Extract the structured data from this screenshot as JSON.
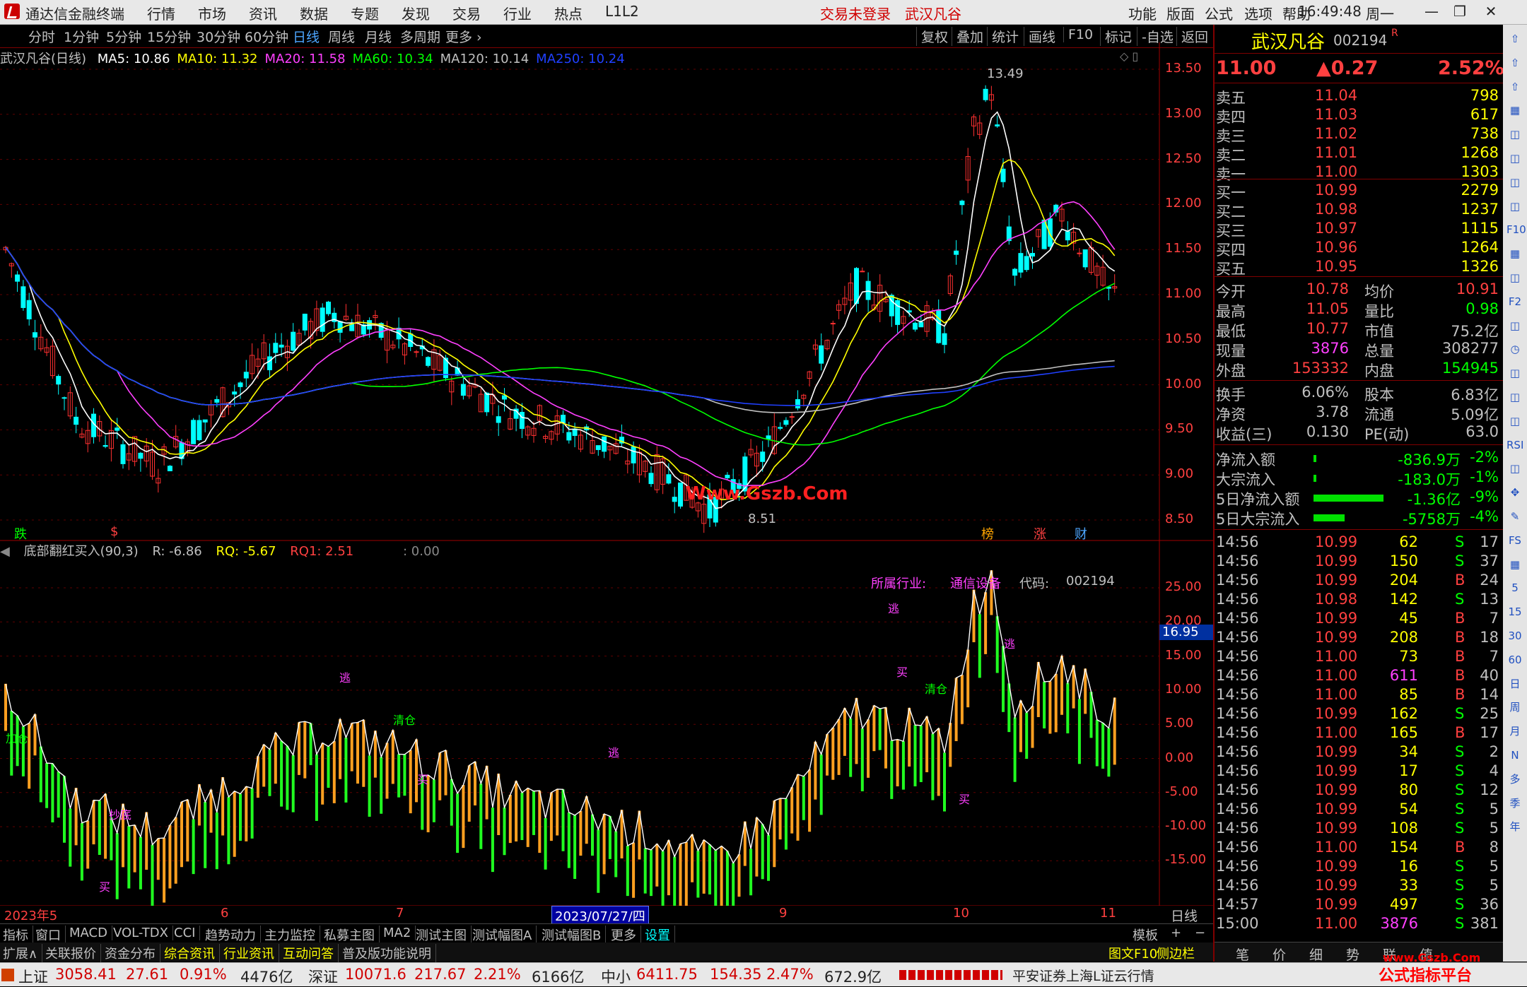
{
  "menubar": {
    "app_title": "通达信金融终端",
    "menus": [
      "行情",
      "市场",
      "资讯",
      "数据",
      "专题",
      "发现",
      "交易",
      "行业",
      "热点",
      "L1L2"
    ],
    "trade_status": "交易未登录",
    "stock_name": "武汉凡谷",
    "right_menus": [
      "功能",
      "版面",
      "公式",
      "选项",
      "帮助"
    ],
    "time": "16:49:48",
    "weekday": "周一"
  },
  "periodbar": {
    "periods": [
      "分时",
      "1分钟",
      "5分钟",
      "15分钟",
      "30分钟",
      "60分钟",
      "日线",
      "周线",
      "月线",
      "多周期",
      "更多 ›"
    ],
    "active_index": 6,
    "right_buttons": [
      "复权",
      "叠加",
      "统计",
      "画线",
      "F10",
      "标记",
      "-自选",
      "返回"
    ]
  },
  "main_chart": {
    "title": "武汉凡谷(日线)",
    "ma": [
      {
        "label": "MA5: 10.86",
        "color": "#ffffff"
      },
      {
        "label": "MA10: 11.32",
        "color": "#ffff00"
      },
      {
        "label": "MA20: 11.58",
        "color": "#ff40ff"
      },
      {
        "label": "MA60: 10.34",
        "color": "#00ff00"
      },
      {
        "label": "MA120: 10.14",
        "color": "#c0c0c0"
      },
      {
        "label": "MA250: 10.24",
        "color": "#2040ff"
      }
    ],
    "y_ticks": [
      "13.50",
      "13.00",
      "12.50",
      "12.00",
      "11.50",
      "11.00",
      "10.50",
      "10.00",
      "9.50",
      "9.00",
      "8.50"
    ],
    "high_label": "13.49",
    "low_label": "8.51",
    "watermark": "Www.Gszb.Com",
    "markers": [
      {
        "text": "跌",
        "color": "#00ff00"
      },
      {
        "text": "$",
        "color": "#ff4040"
      },
      {
        "text": "榜",
        "color": "#ffa500"
      },
      {
        "text": "涨",
        "color": "#ff4040"
      },
      {
        "text": "财",
        "color": "#4da6ff"
      }
    ]
  },
  "indicator": {
    "name": "底部翻红买入(90,3)",
    "r": "R: -6.86",
    "rq": "RQ: -5.67",
    "rq1": "RQ1: 2.51",
    "extra": ": 0.00",
    "industry_label": "所属行业:",
    "industry": "通信设备",
    "code_label": "代码:",
    "code": "002194",
    "y_ticks": [
      "25.00",
      "20.00",
      "15.00",
      "10.00",
      "5.00",
      "0.00",
      "-5.00",
      "-10.00",
      "-15.00"
    ],
    "current_value": "16.95",
    "signal_labels": [
      "逃",
      "买",
      "清仓",
      "抄底",
      "加仓"
    ]
  },
  "x_axis": {
    "labels": [
      "2023年5",
      "6",
      "7",
      "2023/07/27/四",
      "9",
      "10",
      "11"
    ],
    "period": "日线"
  },
  "tabs1": [
    "指标",
    "窗口",
    "MACD",
    "VOL-TDX",
    "CCI",
    "趋势动力",
    "主力监控",
    "私募主图",
    "MA2",
    "测试主图",
    "测试幅图A",
    "测试幅图B",
    "更多",
    "设置"
  ],
  "tabs1_right": [
    "模板",
    "+",
    "−"
  ],
  "tabs2": [
    "扩展∧",
    "关联报价",
    "资金分布",
    "综合资讯",
    "行业资讯",
    "互动问答",
    "普及版功能说明"
  ],
  "tabs2_right": [
    "图文F10",
    "侧边栏 《"
  ],
  "quote": {
    "name": "武汉凡谷",
    "code": "002194",
    "r_mark": "R",
    "price": "11.00",
    "change": "▲0.27",
    "pct": "2.52%",
    "asks": [
      {
        "label": "卖五",
        "price": "11.04",
        "vol": "798"
      },
      {
        "label": "卖四",
        "price": "11.03",
        "vol": "617"
      },
      {
        "label": "卖三",
        "price": "11.02",
        "vol": "738"
      },
      {
        "label": "卖二",
        "price": "11.01",
        "vol": "1268"
      },
      {
        "label": "卖一",
        "price": "11.00",
        "vol": "1303"
      }
    ],
    "bids": [
      {
        "label": "买一",
        "price": "10.99",
        "vol": "2279"
      },
      {
        "label": "买二",
        "price": "10.98",
        "vol": "1237"
      },
      {
        "label": "买三",
        "price": "10.97",
        "vol": "1115"
      },
      {
        "label": "买四",
        "price": "10.96",
        "vol": "1264"
      },
      {
        "label": "买五",
        "price": "10.95",
        "vol": "1326"
      }
    ],
    "stats": [
      {
        "l1": "今开",
        "v1": "10.78",
        "l2": "均价",
        "v2": "10.91",
        "c1": "#ff4040",
        "c2": "#ff4040"
      },
      {
        "l1": "最高",
        "v1": "11.05",
        "l2": "量比",
        "v2": "0.98",
        "c1": "#ff4040",
        "c2": "#00ff00"
      },
      {
        "l1": "最低",
        "v1": "10.77",
        "l2": "市值",
        "v2": "75.2亿",
        "c1": "#ff4040",
        "c2": "#c0c0c0"
      },
      {
        "l1": "现量",
        "v1": "3876",
        "l2": "总量",
        "v2": "308277",
        "c1": "#ff40ff",
        "c2": "#c0c0c0"
      },
      {
        "l1": "外盘",
        "v1": "153332",
        "l2": "内盘",
        "v2": "154945",
        "c1": "#ff4040",
        "c2": "#00ff00"
      }
    ],
    "stats2": [
      {
        "l1": "换手",
        "v1": "6.06%",
        "l2": "股本",
        "v2": "6.83亿"
      },
      {
        "l1": "净资",
        "v1": "3.78",
        "l2": "流通",
        "v2": "5.09亿"
      },
      {
        "l1": "收益(三)",
        "v1": "0.130",
        "l2": "PE(动)",
        "v2": "63.0"
      }
    ],
    "flows": [
      {
        "label": "净流入额",
        "value": "-836.9万",
        "pct": "-2%",
        "bar": 0.02
      },
      {
        "label": "大宗流入",
        "value": "-183.0万",
        "pct": "-1%",
        "bar": 0.01
      },
      {
        "label": "5日净流入额",
        "value": "-1.36亿",
        "pct": "-9%",
        "bar": 0.9
      },
      {
        "label": "5日大宗流入",
        "value": "-5758万",
        "pct": "-4%",
        "bar": 0.4
      }
    ],
    "ticks": [
      [
        "14:56",
        "10.99",
        "62",
        "S",
        "17"
      ],
      [
        "14:56",
        "10.99",
        "150",
        "S",
        "37"
      ],
      [
        "14:56",
        "10.99",
        "204",
        "B",
        "24"
      ],
      [
        "14:56",
        "10.98",
        "142",
        "S",
        "13"
      ],
      [
        "14:56",
        "10.99",
        "45",
        "B",
        "7"
      ],
      [
        "14:56",
        "10.99",
        "208",
        "B",
        "18"
      ],
      [
        "14:56",
        "11.00",
        "73",
        "B",
        "7"
      ],
      [
        "14:56",
        "11.00",
        "611",
        "B",
        "40"
      ],
      [
        "14:56",
        "11.00",
        "85",
        "B",
        "14"
      ],
      [
        "14:56",
        "10.99",
        "162",
        "S",
        "25"
      ],
      [
        "14:56",
        "11.00",
        "165",
        "B",
        "17"
      ],
      [
        "14:56",
        "10.99",
        "34",
        "S",
        "2"
      ],
      [
        "14:56",
        "10.99",
        "17",
        "S",
        "4"
      ],
      [
        "14:56",
        "10.99",
        "80",
        "S",
        "12"
      ],
      [
        "14:56",
        "10.99",
        "54",
        "S",
        "5"
      ],
      [
        "14:56",
        "10.99",
        "108",
        "S",
        "5"
      ],
      [
        "14:56",
        "11.00",
        "154",
        "B",
        "8"
      ],
      [
        "14:56",
        "10.99",
        "16",
        "S",
        "5"
      ],
      [
        "14:56",
        "10.99",
        "33",
        "S",
        "5"
      ],
      [
        "14:57",
        "10.99",
        "497",
        "S",
        "36"
      ],
      [
        "15:00",
        "11.00",
        "3876",
        "S",
        "381"
      ]
    ],
    "bottom_tabs": [
      "笔",
      "价",
      "细",
      "势",
      "联",
      "值"
    ]
  },
  "side_icons": [
    "up-icon",
    "up-icon",
    "up-icon",
    "grid-icon",
    "chart-icon",
    "chart-icon",
    "chart-icon",
    "chart-icon",
    "F10",
    "grid-icon",
    "chart-icon",
    "F2",
    "chart-icon",
    "clock-icon",
    "chart-icon",
    "chart-icon",
    "chart-icon",
    "RSI",
    "chart-icon",
    "move-icon",
    "pen-icon",
    "FS",
    "grid-icon",
    "5",
    "15",
    "30",
    "60",
    "日",
    "周",
    "月",
    "N",
    "多",
    "季",
    "年"
  ],
  "statusbar": {
    "sh_label": "上证",
    "sh_val": "3058.41",
    "sh_chg": "27.61",
    "sh_pct": "0.91%",
    "sh_amt": "4476亿",
    "sz_label": "深证",
    "sz_val": "10071.6",
    "sz_chg": "217.67",
    "sz_pct": "2.21%",
    "sz_amt": "6166亿",
    "zx_label": "中小",
    "zx_val": "6411.75",
    "zx_chg": "154.35",
    "zx_pct": "2.47%",
    "zx_amt": "672.9亿",
    "broker": "平安证券上海L证云行情",
    "brand": "公式指标平台",
    "brand_url": "www.Gszb.Com"
  }
}
